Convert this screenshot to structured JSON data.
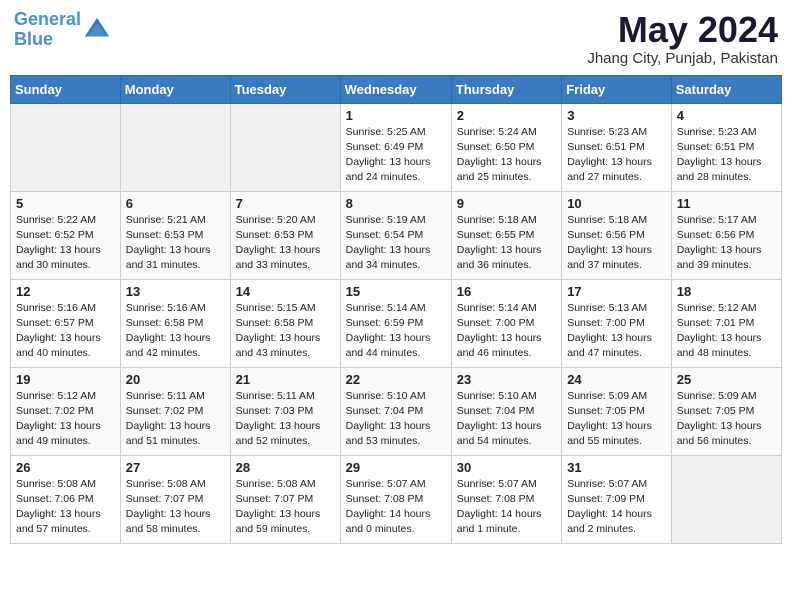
{
  "logo": {
    "line1": "General",
    "line2": "Blue"
  },
  "title": "May 2024",
  "subtitle": "Jhang City, Punjab, Pakistan",
  "columns": [
    "Sunday",
    "Monday",
    "Tuesday",
    "Wednesday",
    "Thursday",
    "Friday",
    "Saturday"
  ],
  "weeks": [
    [
      {
        "day": "",
        "sunrise": "",
        "sunset": "",
        "daylight": ""
      },
      {
        "day": "",
        "sunrise": "",
        "sunset": "",
        "daylight": ""
      },
      {
        "day": "",
        "sunrise": "",
        "sunset": "",
        "daylight": ""
      },
      {
        "day": "1",
        "sunrise": "Sunrise: 5:25 AM",
        "sunset": "Sunset: 6:49 PM",
        "daylight": "Daylight: 13 hours and 24 minutes."
      },
      {
        "day": "2",
        "sunrise": "Sunrise: 5:24 AM",
        "sunset": "Sunset: 6:50 PM",
        "daylight": "Daylight: 13 hours and 25 minutes."
      },
      {
        "day": "3",
        "sunrise": "Sunrise: 5:23 AM",
        "sunset": "Sunset: 6:51 PM",
        "daylight": "Daylight: 13 hours and 27 minutes."
      },
      {
        "day": "4",
        "sunrise": "Sunrise: 5:23 AM",
        "sunset": "Sunset: 6:51 PM",
        "daylight": "Daylight: 13 hours and 28 minutes."
      }
    ],
    [
      {
        "day": "5",
        "sunrise": "Sunrise: 5:22 AM",
        "sunset": "Sunset: 6:52 PM",
        "daylight": "Daylight: 13 hours and 30 minutes."
      },
      {
        "day": "6",
        "sunrise": "Sunrise: 5:21 AM",
        "sunset": "Sunset: 6:53 PM",
        "daylight": "Daylight: 13 hours and 31 minutes."
      },
      {
        "day": "7",
        "sunrise": "Sunrise: 5:20 AM",
        "sunset": "Sunset: 6:53 PM",
        "daylight": "Daylight: 13 hours and 33 minutes."
      },
      {
        "day": "8",
        "sunrise": "Sunrise: 5:19 AM",
        "sunset": "Sunset: 6:54 PM",
        "daylight": "Daylight: 13 hours and 34 minutes."
      },
      {
        "day": "9",
        "sunrise": "Sunrise: 5:18 AM",
        "sunset": "Sunset: 6:55 PM",
        "daylight": "Daylight: 13 hours and 36 minutes."
      },
      {
        "day": "10",
        "sunrise": "Sunrise: 5:18 AM",
        "sunset": "Sunset: 6:56 PM",
        "daylight": "Daylight: 13 hours and 37 minutes."
      },
      {
        "day": "11",
        "sunrise": "Sunrise: 5:17 AM",
        "sunset": "Sunset: 6:56 PM",
        "daylight": "Daylight: 13 hours and 39 minutes."
      }
    ],
    [
      {
        "day": "12",
        "sunrise": "Sunrise: 5:16 AM",
        "sunset": "Sunset: 6:57 PM",
        "daylight": "Daylight: 13 hours and 40 minutes."
      },
      {
        "day": "13",
        "sunrise": "Sunrise: 5:16 AM",
        "sunset": "Sunset: 6:58 PM",
        "daylight": "Daylight: 13 hours and 42 minutes."
      },
      {
        "day": "14",
        "sunrise": "Sunrise: 5:15 AM",
        "sunset": "Sunset: 6:58 PM",
        "daylight": "Daylight: 13 hours and 43 minutes."
      },
      {
        "day": "15",
        "sunrise": "Sunrise: 5:14 AM",
        "sunset": "Sunset: 6:59 PM",
        "daylight": "Daylight: 13 hours and 44 minutes."
      },
      {
        "day": "16",
        "sunrise": "Sunrise: 5:14 AM",
        "sunset": "Sunset: 7:00 PM",
        "daylight": "Daylight: 13 hours and 46 minutes."
      },
      {
        "day": "17",
        "sunrise": "Sunrise: 5:13 AM",
        "sunset": "Sunset: 7:00 PM",
        "daylight": "Daylight: 13 hours and 47 minutes."
      },
      {
        "day": "18",
        "sunrise": "Sunrise: 5:12 AM",
        "sunset": "Sunset: 7:01 PM",
        "daylight": "Daylight: 13 hours and 48 minutes."
      }
    ],
    [
      {
        "day": "19",
        "sunrise": "Sunrise: 5:12 AM",
        "sunset": "Sunset: 7:02 PM",
        "daylight": "Daylight: 13 hours and 49 minutes."
      },
      {
        "day": "20",
        "sunrise": "Sunrise: 5:11 AM",
        "sunset": "Sunset: 7:02 PM",
        "daylight": "Daylight: 13 hours and 51 minutes."
      },
      {
        "day": "21",
        "sunrise": "Sunrise: 5:11 AM",
        "sunset": "Sunset: 7:03 PM",
        "daylight": "Daylight: 13 hours and 52 minutes."
      },
      {
        "day": "22",
        "sunrise": "Sunrise: 5:10 AM",
        "sunset": "Sunset: 7:04 PM",
        "daylight": "Daylight: 13 hours and 53 minutes."
      },
      {
        "day": "23",
        "sunrise": "Sunrise: 5:10 AM",
        "sunset": "Sunset: 7:04 PM",
        "daylight": "Daylight: 13 hours and 54 minutes."
      },
      {
        "day": "24",
        "sunrise": "Sunrise: 5:09 AM",
        "sunset": "Sunset: 7:05 PM",
        "daylight": "Daylight: 13 hours and 55 minutes."
      },
      {
        "day": "25",
        "sunrise": "Sunrise: 5:09 AM",
        "sunset": "Sunset: 7:05 PM",
        "daylight": "Daylight: 13 hours and 56 minutes."
      }
    ],
    [
      {
        "day": "26",
        "sunrise": "Sunrise: 5:08 AM",
        "sunset": "Sunset: 7:06 PM",
        "daylight": "Daylight: 13 hours and 57 minutes."
      },
      {
        "day": "27",
        "sunrise": "Sunrise: 5:08 AM",
        "sunset": "Sunset: 7:07 PM",
        "daylight": "Daylight: 13 hours and 58 minutes."
      },
      {
        "day": "28",
        "sunrise": "Sunrise: 5:08 AM",
        "sunset": "Sunset: 7:07 PM",
        "daylight": "Daylight: 13 hours and 59 minutes."
      },
      {
        "day": "29",
        "sunrise": "Sunrise: 5:07 AM",
        "sunset": "Sunset: 7:08 PM",
        "daylight": "Daylight: 14 hours and 0 minutes."
      },
      {
        "day": "30",
        "sunrise": "Sunrise: 5:07 AM",
        "sunset": "Sunset: 7:08 PM",
        "daylight": "Daylight: 14 hours and 1 minute."
      },
      {
        "day": "31",
        "sunrise": "Sunrise: 5:07 AM",
        "sunset": "Sunset: 7:09 PM",
        "daylight": "Daylight: 14 hours and 2 minutes."
      },
      {
        "day": "",
        "sunrise": "",
        "sunset": "",
        "daylight": ""
      }
    ]
  ]
}
